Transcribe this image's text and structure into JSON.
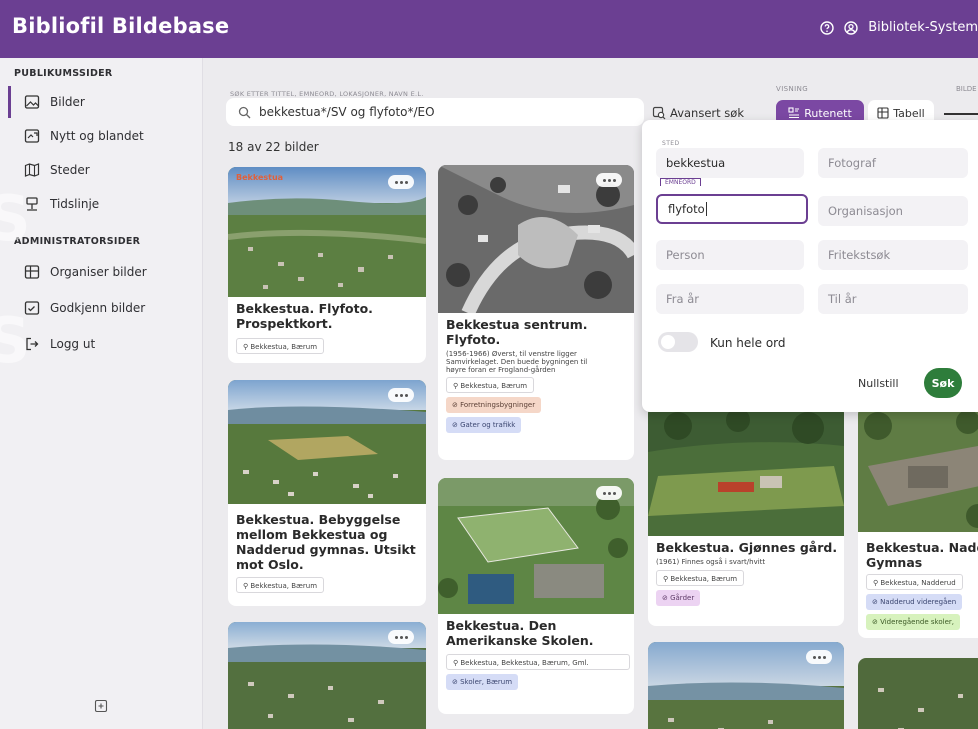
{
  "app": {
    "title": "Bibliofil Bildebase",
    "user": "Bibliotek-System"
  },
  "sidebar": {
    "public_heading": "PUBLIKUMSSIDER",
    "public_items": [
      {
        "label": "Bilder",
        "icon": "image-icon"
      },
      {
        "label": "Nytt og blandet",
        "icon": "shuffle-image-icon"
      },
      {
        "label": "Steder",
        "icon": "map-icon"
      },
      {
        "label": "Tidslinje",
        "icon": "timeline-icon"
      }
    ],
    "admin_heading": "ADMINISTRATORSIDER",
    "admin_items": [
      {
        "label": "Organiser bilder",
        "icon": "grid-icon"
      },
      {
        "label": "Godkjenn bilder",
        "icon": "approve-image-icon"
      },
      {
        "label": "Logg ut",
        "icon": "logout-icon"
      }
    ]
  },
  "search": {
    "label": "SØK ETTER TITTEL, EMNEORD, LOKASJONER, NAVN E.L.",
    "value": "bekkestua*/SV og flyfoto*/EO",
    "result_count": "18 av 22 bilder",
    "advanced_label": "Avansert søk"
  },
  "view": {
    "label": "VISNING",
    "grid_label": "Rutenett",
    "table_label": "Tabell",
    "bilder_label": "BILDE"
  },
  "advanced": {
    "sted_label": "STED",
    "sted_value": "bekkestua",
    "emneord_label": "EMNEORD",
    "emneord_value": "flyfoto",
    "fotograf": "Fotograf",
    "organisasjon": "Organisasjon",
    "person": "Person",
    "fritekst": "Fritekstsøk",
    "fra_ar": "Fra år",
    "til_ar": "Til år",
    "whole_word": "Kun hele ord",
    "reset": "Nullstill",
    "search": "Søk"
  },
  "cards": [
    {
      "title_1": "Bekkestua. Flyfoto.",
      "title_2": "Prospektkort.",
      "stamp": "Bekkestua",
      "tags": [
        "Bekkestua, Bærum"
      ]
    },
    {
      "title_1": "Bekkestua sentrum.",
      "title_2": "Flyfoto.",
      "desc_1": "(1956-1966) Øverst, til venstre ligger",
      "desc_2": "Samvirkelaget. Den buede bygningen til",
      "desc_3": "høyre foran er Frogland-gården",
      "tags": [
        "Bekkestua, Bærum",
        "Forretningsbygninger",
        "Gater og trafikk"
      ]
    },
    {
      "title_1": "Bekkestua. Bebyggelse",
      "title_2": "mellom Bekkestua og",
      "title_3": "Nadderud gymnas. Utsikt",
      "title_4": "mot Oslo.",
      "tags": [
        "Bekkestua, Bærum"
      ]
    },
    {
      "title_1": "Bekkestua. Den",
      "title_2": "Amerikanske Skolen.",
      "tags": [
        "Bekkestua, Bekkestua, Bærum, Gml.",
        "Skoler, Bærum"
      ]
    },
    {
      "title_1": "Bekkestua. Gjønnes gård.",
      "desc_1": "(1961) Finnes også i svart/hvitt",
      "tags": [
        "Bekkestua, Bærum",
        "Gårder"
      ]
    },
    {
      "title_1": "Bekkestua. Nadd",
      "title_2": "Gymnas",
      "tags": [
        "Bekkestua, Nadderud",
        "Nadderud videregåen",
        "Videregående skoler,"
      ]
    }
  ]
}
